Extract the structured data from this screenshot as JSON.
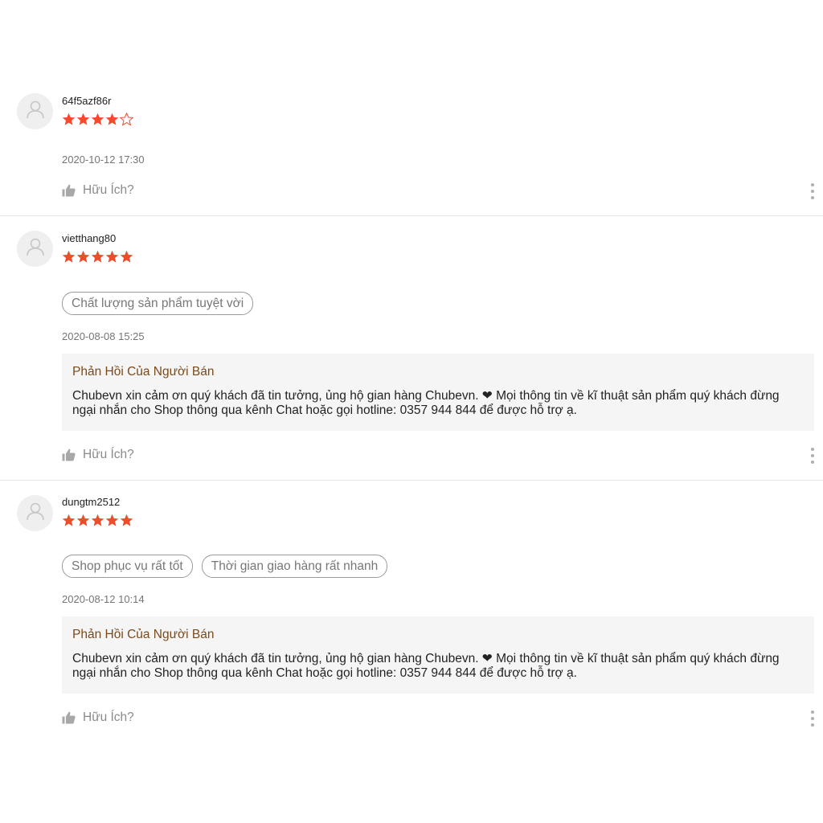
{
  "colors": {
    "star_filled": "#ee4d2d",
    "seller_reply_title": "#7a4a1c",
    "seller_reply_bg": "#f5f5f5"
  },
  "icons": {
    "avatar": "user-placeholder-icon",
    "helpful": "thumbs-up-icon",
    "more": "vertical-ellipsis-icon",
    "reply_heart": "heart-icon"
  },
  "reviews": [
    {
      "username": "64f5azf86r",
      "rating": 4,
      "max_rating": 5,
      "tags": [],
      "timestamp": "2020-10-12 17:30",
      "seller_reply": null,
      "helpful_label": "Hữu Ích?"
    },
    {
      "username": "vietthang80",
      "rating": 5,
      "max_rating": 5,
      "tags": [
        "Chất lượng sản phẩm tuyệt vời"
      ],
      "timestamp": "2020-08-08 15:25",
      "seller_reply": {
        "title": "Phản Hồi Của Người Bán",
        "text": "Chubevn xin cảm ơn quý khách đã tin tưởng, ủng hộ gian hàng Chubevn. ❤ Mọi thông tin về kĩ thuật sản phẩm quý khách đừng ngại nhắn cho Shop thông qua kênh Chat hoặc gọi hotline: 0357 944 844 để được hỗ trợ ạ."
      },
      "helpful_label": "Hữu Ích?"
    },
    {
      "username": "dungtm2512",
      "rating": 5,
      "max_rating": 5,
      "tags": [
        "Shop phục vụ rất tốt",
        "Thời gian giao hàng rất nhanh"
      ],
      "timestamp": "2020-08-12 10:14",
      "seller_reply": {
        "title": "Phản Hồi Của Người Bán",
        "text": "Chubevn xin cảm ơn quý khách đã tin tưởng, ủng hộ gian hàng Chubevn. ❤ Mọi thông tin về kĩ thuật sản phẩm quý khách đừng ngại nhắn cho Shop thông qua kênh Chat hoặc gọi hotline: 0357 944 844 để được hỗ trợ ạ."
      },
      "helpful_label": "Hữu Ích?"
    }
  ]
}
